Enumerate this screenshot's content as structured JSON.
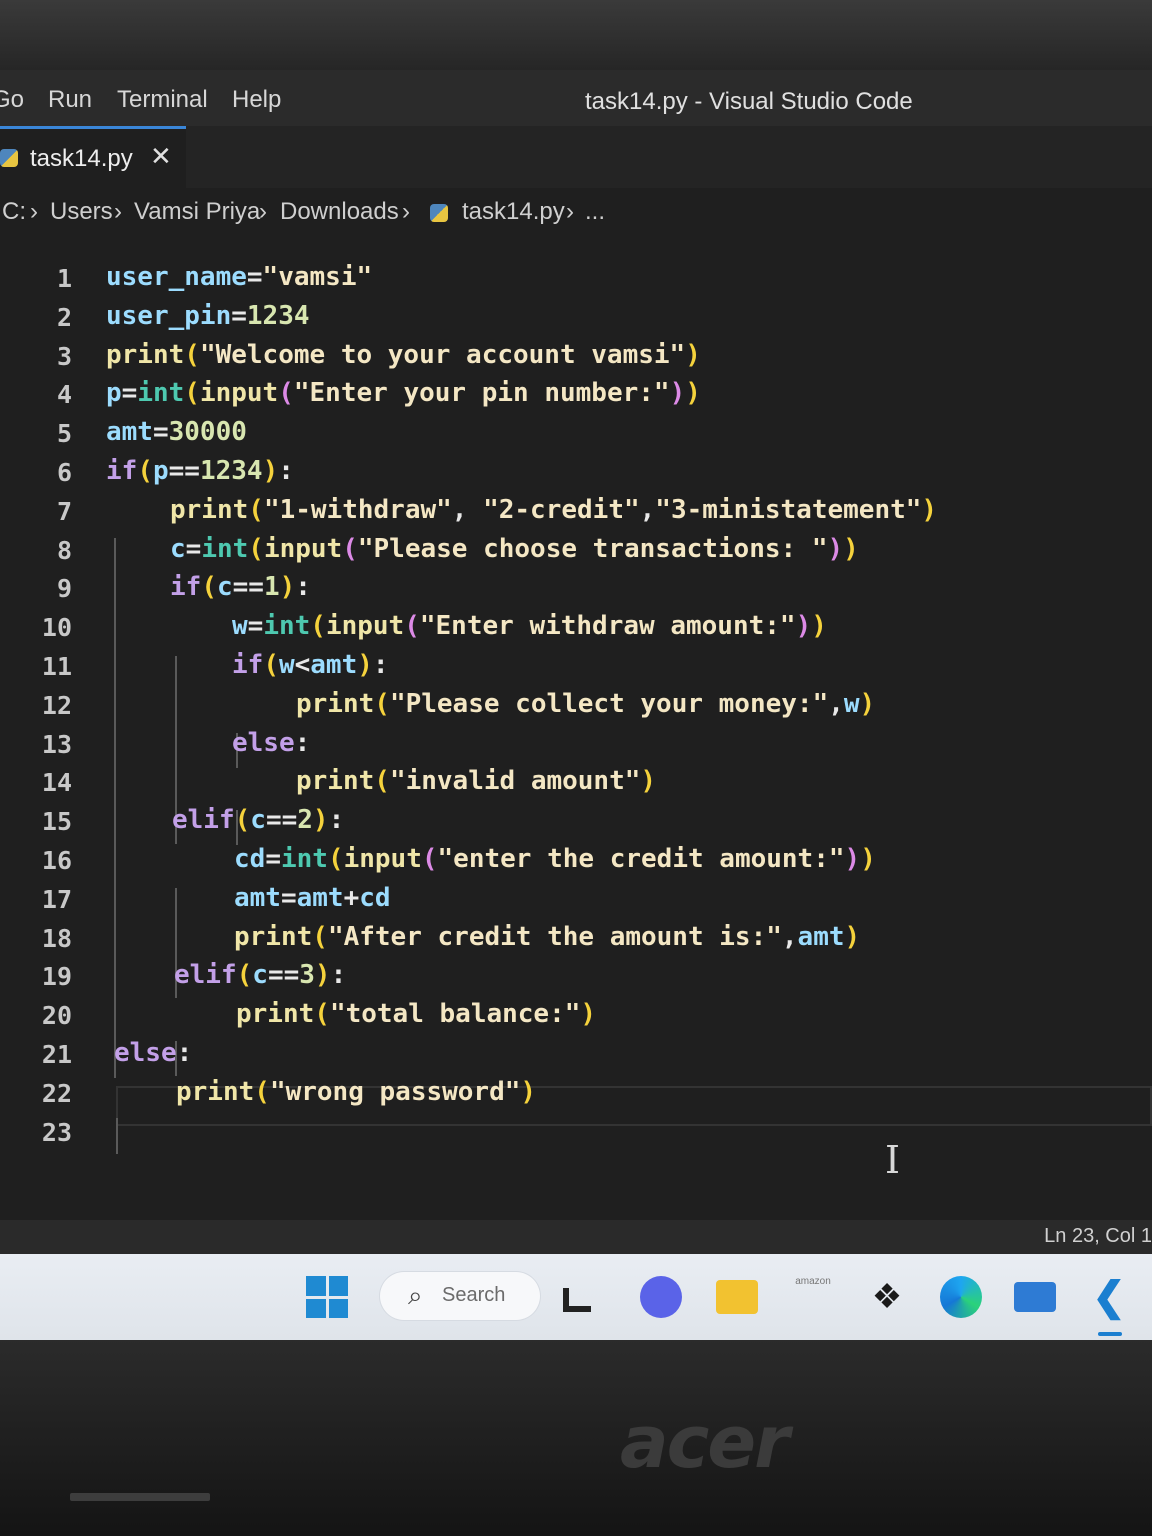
{
  "menu": [
    "Go",
    "Run",
    "Terminal",
    "Help"
  ],
  "window_title": "task14.py - Visual Studio Code",
  "tab": {
    "label": "task14.py",
    "close": "✕"
  },
  "breadcrumb": [
    "C:",
    "Users",
    "Vamsi Priya",
    "Downloads",
    "task14.py",
    "..."
  ],
  "line_numbers": [
    "1",
    "2",
    "3",
    "4",
    "5",
    "6",
    "7",
    "8",
    "9",
    "10",
    "11",
    "12",
    "13",
    "14",
    "15",
    "16",
    "17",
    "18",
    "19",
    "20",
    "21",
    "22",
    "23"
  ],
  "code_lines": [
    "user_name=\"vamsi\"",
    "user_pin=1234",
    "print(\"Welcome to your account vamsi\")",
    "p=int(input(\"Enter your pin number:\"))",
    "amt=30000",
    "if(p==1234):",
    "print(\"1-withdraw\", \"2-credit\",\"3-ministatement\")",
    "c=int(input(\"Please choose transactions: \"))",
    "if(c==1):",
    "w=int(input(\"Enter withdraw amount:\"))",
    "if(w<amt):",
    "print(\"Please collect your money:\",w)",
    "else:",
    "print(\"invalid amount\")",
    "elif(c==2):",
    "cd=int(input(\"enter the credit amount:\"))",
    "amt=amt+cd",
    "print(\"After credit the amount is:\",amt)",
    "elif(c==3):",
    "print(\"total balance:\")",
    "else:",
    "print(\"wrong password\")",
    ""
  ],
  "status": {
    "position": "Ln 23, Col 1"
  },
  "taskbar": {
    "search_placeholder": "Search",
    "amazon_label": "amazon"
  },
  "icons": [
    "windows-start-icon",
    "search-icon",
    "widgets-icon",
    "chat-icon",
    "file-explorer-icon",
    "amazon-icon",
    "dropbox-icon",
    "edge-icon",
    "mail-icon",
    "vscode-icon"
  ],
  "brand": "acer"
}
